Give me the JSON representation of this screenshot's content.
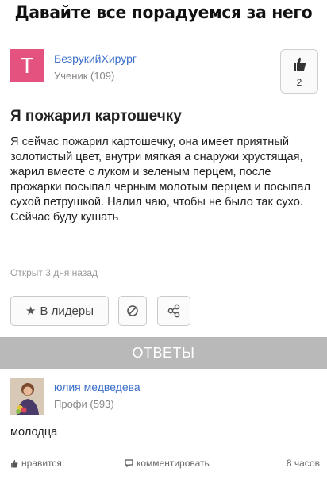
{
  "caption": "Давайте все порадуемся за него",
  "question": {
    "avatar_letter": "T",
    "author_name": "БезрукийХирург",
    "author_rank": "Ученик (109)",
    "likes": "2",
    "title": "Я пожарил картошечку",
    "body": "Я сейчас пожарил картошечку, она имеет приятный золотистый цвет, внутри мягкая а снаружи хрустящая, жарил вместе с луком и зеленым перцем, после прожарки посыпал черным молотым перцем и посыпал сухой петрушкой. Налил чаю, чтобы не было так сухо. Сейчас буду кушать",
    "time": "Открыт 3 дня назад"
  },
  "actions": {
    "leaders_label": "В лидеры",
    "leaders_icon": "star-icon",
    "block_icon": "block-icon",
    "share_icon": "share-icon"
  },
  "answers_header": "ОТВЕТЫ",
  "answer": {
    "author_name": "юлия медведева",
    "author_rank": "Профи (593)",
    "text": "молодца",
    "like_label": "нравится",
    "comment_label": "комментировать",
    "time": "8 часов"
  },
  "colors": {
    "avatar_bg": "#e4527f",
    "link": "#3b6fc8",
    "answers_bar": "#b9b9b9"
  }
}
